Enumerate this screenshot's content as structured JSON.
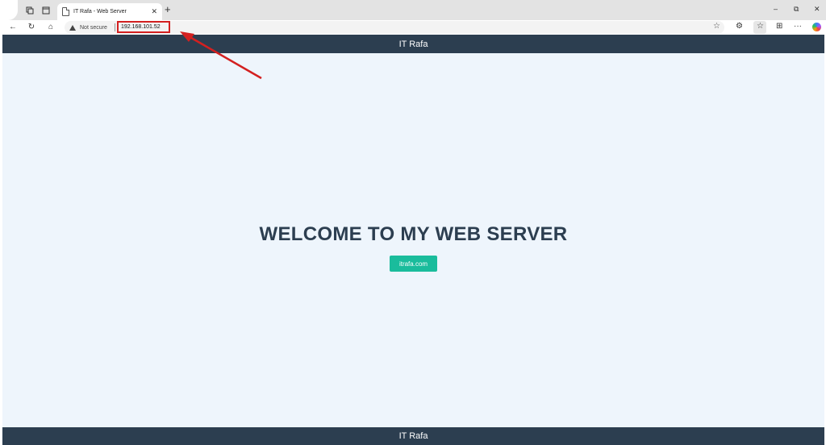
{
  "browser": {
    "tab": {
      "title": "IT Rafa - Web Server",
      "close_glyph": "✕"
    },
    "new_tab_glyph": "+",
    "window_controls": {
      "minimize": "–",
      "restore": "⧉",
      "close": "✕"
    },
    "nav": {
      "back": "←",
      "reload": "↻",
      "home": "⌂"
    },
    "security_label": "Not secure",
    "address": "192.168.101.52",
    "toolbar_icons": {
      "favorite": "☆",
      "extensions": "⚙",
      "favorites": "☆",
      "collections": "⊞",
      "more": "···"
    }
  },
  "annotation": {
    "color": "#d32020"
  },
  "page": {
    "header_title": "IT Rafa",
    "hero_title": "WELCOME TO MY WEB SERVER",
    "hero_button": "itrafa.com",
    "footer_text": "IT Rafa"
  },
  "colors": {
    "header_bg": "#2c3e50",
    "page_bg": "#eef5fc",
    "button_bg": "#1abc9c",
    "title_color": "#2c3e50"
  }
}
